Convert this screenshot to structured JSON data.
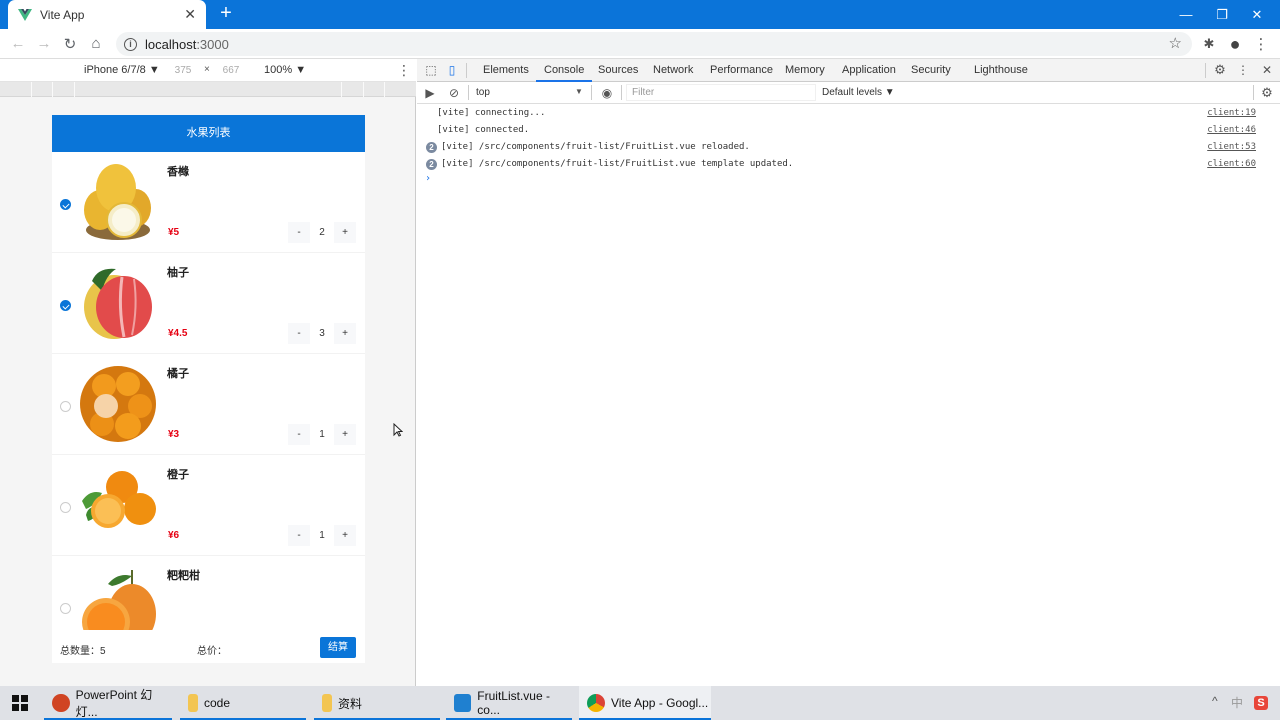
{
  "browser": {
    "tab": {
      "title": "Vite App",
      "favicon": "vue-logo-icon",
      "close_icon": "✕"
    },
    "new_tab_icon": "+",
    "window_controls": {
      "minimize": "—",
      "maximize": "❐",
      "close": "✕"
    },
    "nav": {
      "back": "←",
      "forward": "→",
      "reload": "↻",
      "home": "⌂"
    },
    "address": {
      "host": "localhost",
      "port": ":3000",
      "info_icon": "i"
    },
    "toolbar_icons": {
      "bookmark": "☆",
      "extensions": "✱",
      "profile": "●",
      "menu": "⋮"
    }
  },
  "device_toolbar": {
    "device": "iPhone 6/7/8 ▼",
    "width": "375",
    "height": "667",
    "times": "×",
    "zoom": "100% ▼",
    "more": "⋮"
  },
  "app": {
    "header_title": "水果列表",
    "items": [
      {
        "name": "香橼",
        "price": "¥5",
        "count": "2",
        "checked": true,
        "image": "citron"
      },
      {
        "name": "柚子",
        "price": "¥4.5",
        "count": "3",
        "checked": true,
        "image": "pomelo"
      },
      {
        "name": "橘子",
        "price": "¥3",
        "count": "1",
        "checked": false,
        "image": "tangerine"
      },
      {
        "name": "橙子",
        "price": "¥6",
        "count": "1",
        "checked": false,
        "image": "orange"
      },
      {
        "name": "粑粑柑",
        "price": "",
        "count": "",
        "checked": false,
        "image": "dekopon"
      }
    ],
    "stepper": {
      "minus": "-",
      "plus": "+"
    },
    "footer": {
      "total_count_label": "总数量：5",
      "total_price_label": "总价：",
      "checkout_label": "结算"
    }
  },
  "devtools": {
    "tabs": [
      "Elements",
      "Console",
      "Sources",
      "Network",
      "Performance",
      "Memory",
      "Application",
      "Security",
      "Lighthouse"
    ],
    "active_tab": "Console",
    "context": "top",
    "filter_placeholder": "Filter",
    "levels": "Default levels ▼",
    "console_lines": [
      {
        "text": "[vite] connecting...",
        "source": "client:19",
        "badge": ""
      },
      {
        "text": "[vite] connected.",
        "source": "client:46",
        "badge": ""
      },
      {
        "text": "[vite] /src/components/fruit-list/FruitList.vue reloaded.",
        "source": "client:53",
        "badge": "2"
      },
      {
        "text": "[vite] /src/components/fruit-list/FruitList.vue template updated.",
        "source": "client:60",
        "badge": "2"
      }
    ],
    "prompt": "›"
  },
  "taskbar": {
    "items": [
      {
        "label": "PowerPoint 幻灯...",
        "icon": "powerpoint-icon",
        "color": "#d04423"
      },
      {
        "label": "code",
        "icon": "folder-icon",
        "color": "#f3c552"
      },
      {
        "label": "资料",
        "icon": "folder-icon",
        "color": "#f3c552"
      },
      {
        "label": "FruitList.vue - co...",
        "icon": "vscode-icon",
        "color": "#1f80d0"
      },
      {
        "label": "Vite App - Googl...",
        "icon": "chrome-icon",
        "color": "#dd4b39"
      }
    ],
    "tray": {
      "chevron": "^",
      "ime": "中",
      "sogou": "S"
    }
  },
  "colors": {
    "accent": "#0a75d8",
    "price": "#e60012",
    "titlebar": "#0b74d9"
  }
}
